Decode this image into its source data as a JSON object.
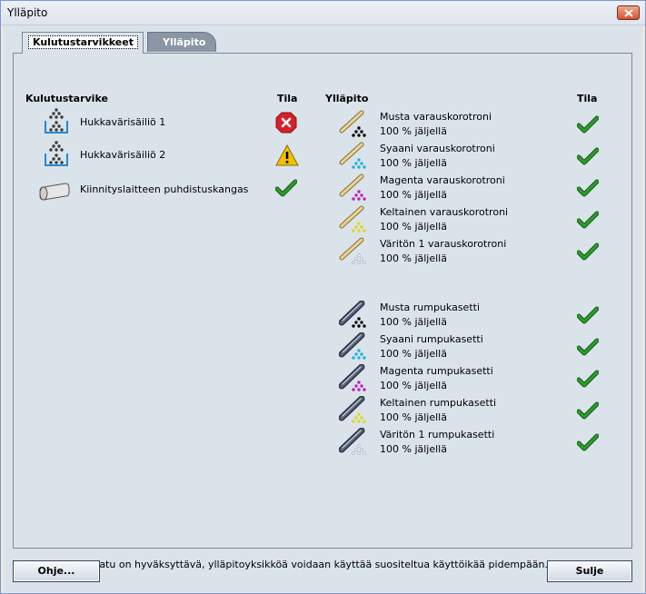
{
  "window": {
    "title": "Ylläpito"
  },
  "tabs": [
    {
      "label": "Kulutustarvikkeet",
      "active": true
    },
    {
      "label": "Ylläpito",
      "active": false
    }
  ],
  "consumables": {
    "header": "Kulutustarvike",
    "status_header": "Tila",
    "items": [
      {
        "name": "Hukkavärisäiliö 1",
        "status": "error",
        "icon": "waste-toner-icon"
      },
      {
        "name": "Hukkavärisäiliö 2",
        "status": "warning",
        "icon": "waste-toner-icon"
      },
      {
        "name": "Kiinnityslaitteen puhdistuskangas",
        "status": "ok",
        "icon": "fuser-web-icon"
      }
    ]
  },
  "maintenance": {
    "header": "Ylläpito",
    "status_header": "Tila",
    "corotrons": [
      {
        "name": "Musta varauskorotroni",
        "remaining": "100 % jäljellä",
        "color": "#000000"
      },
      {
        "name": "Syaani varauskorotroni",
        "remaining": "100 % jäljellä",
        "color": "#19b6d6"
      },
      {
        "name": "Magenta varauskorotroni",
        "remaining": "100 % jäljellä",
        "color": "#c21fb8"
      },
      {
        "name": "Keltainen varauskorotroni",
        "remaining": "100 % jäljellä",
        "color": "#e0d81c"
      },
      {
        "name": "Väritön 1 varauskorotroni",
        "remaining": "100 % jäljellä",
        "color": "#dfe6ee"
      }
    ],
    "drums": [
      {
        "name": "Musta rumpukasetti",
        "remaining": "100 % jäljellä",
        "color": "#000000"
      },
      {
        "name": "Syaani rumpukasetti",
        "remaining": "100 % jäljellä",
        "color": "#19b6d6"
      },
      {
        "name": "Magenta rumpukasetti",
        "remaining": "100 % jäljellä",
        "color": "#c21fb8"
      },
      {
        "name": "Keltainen rumpukasetti",
        "remaining": "100 % jäljellä",
        "color": "#e0d81c"
      },
      {
        "name": "Väritön 1 rumpukasetti",
        "remaining": "100 % jäljellä",
        "color": "#dfe6ee"
      }
    ]
  },
  "footnote": "*Jos tulostuslaatu on hyväksyttävä, ylläpitoyksikköä voidaan käyttää suositeltua käyttöikää pidempään.",
  "buttons": {
    "help": "Ohje...",
    "close": "Sulje"
  },
  "colors": {
    "ok": "#2e9b2e",
    "error": "#d8202a",
    "warning": "#f2c200"
  }
}
